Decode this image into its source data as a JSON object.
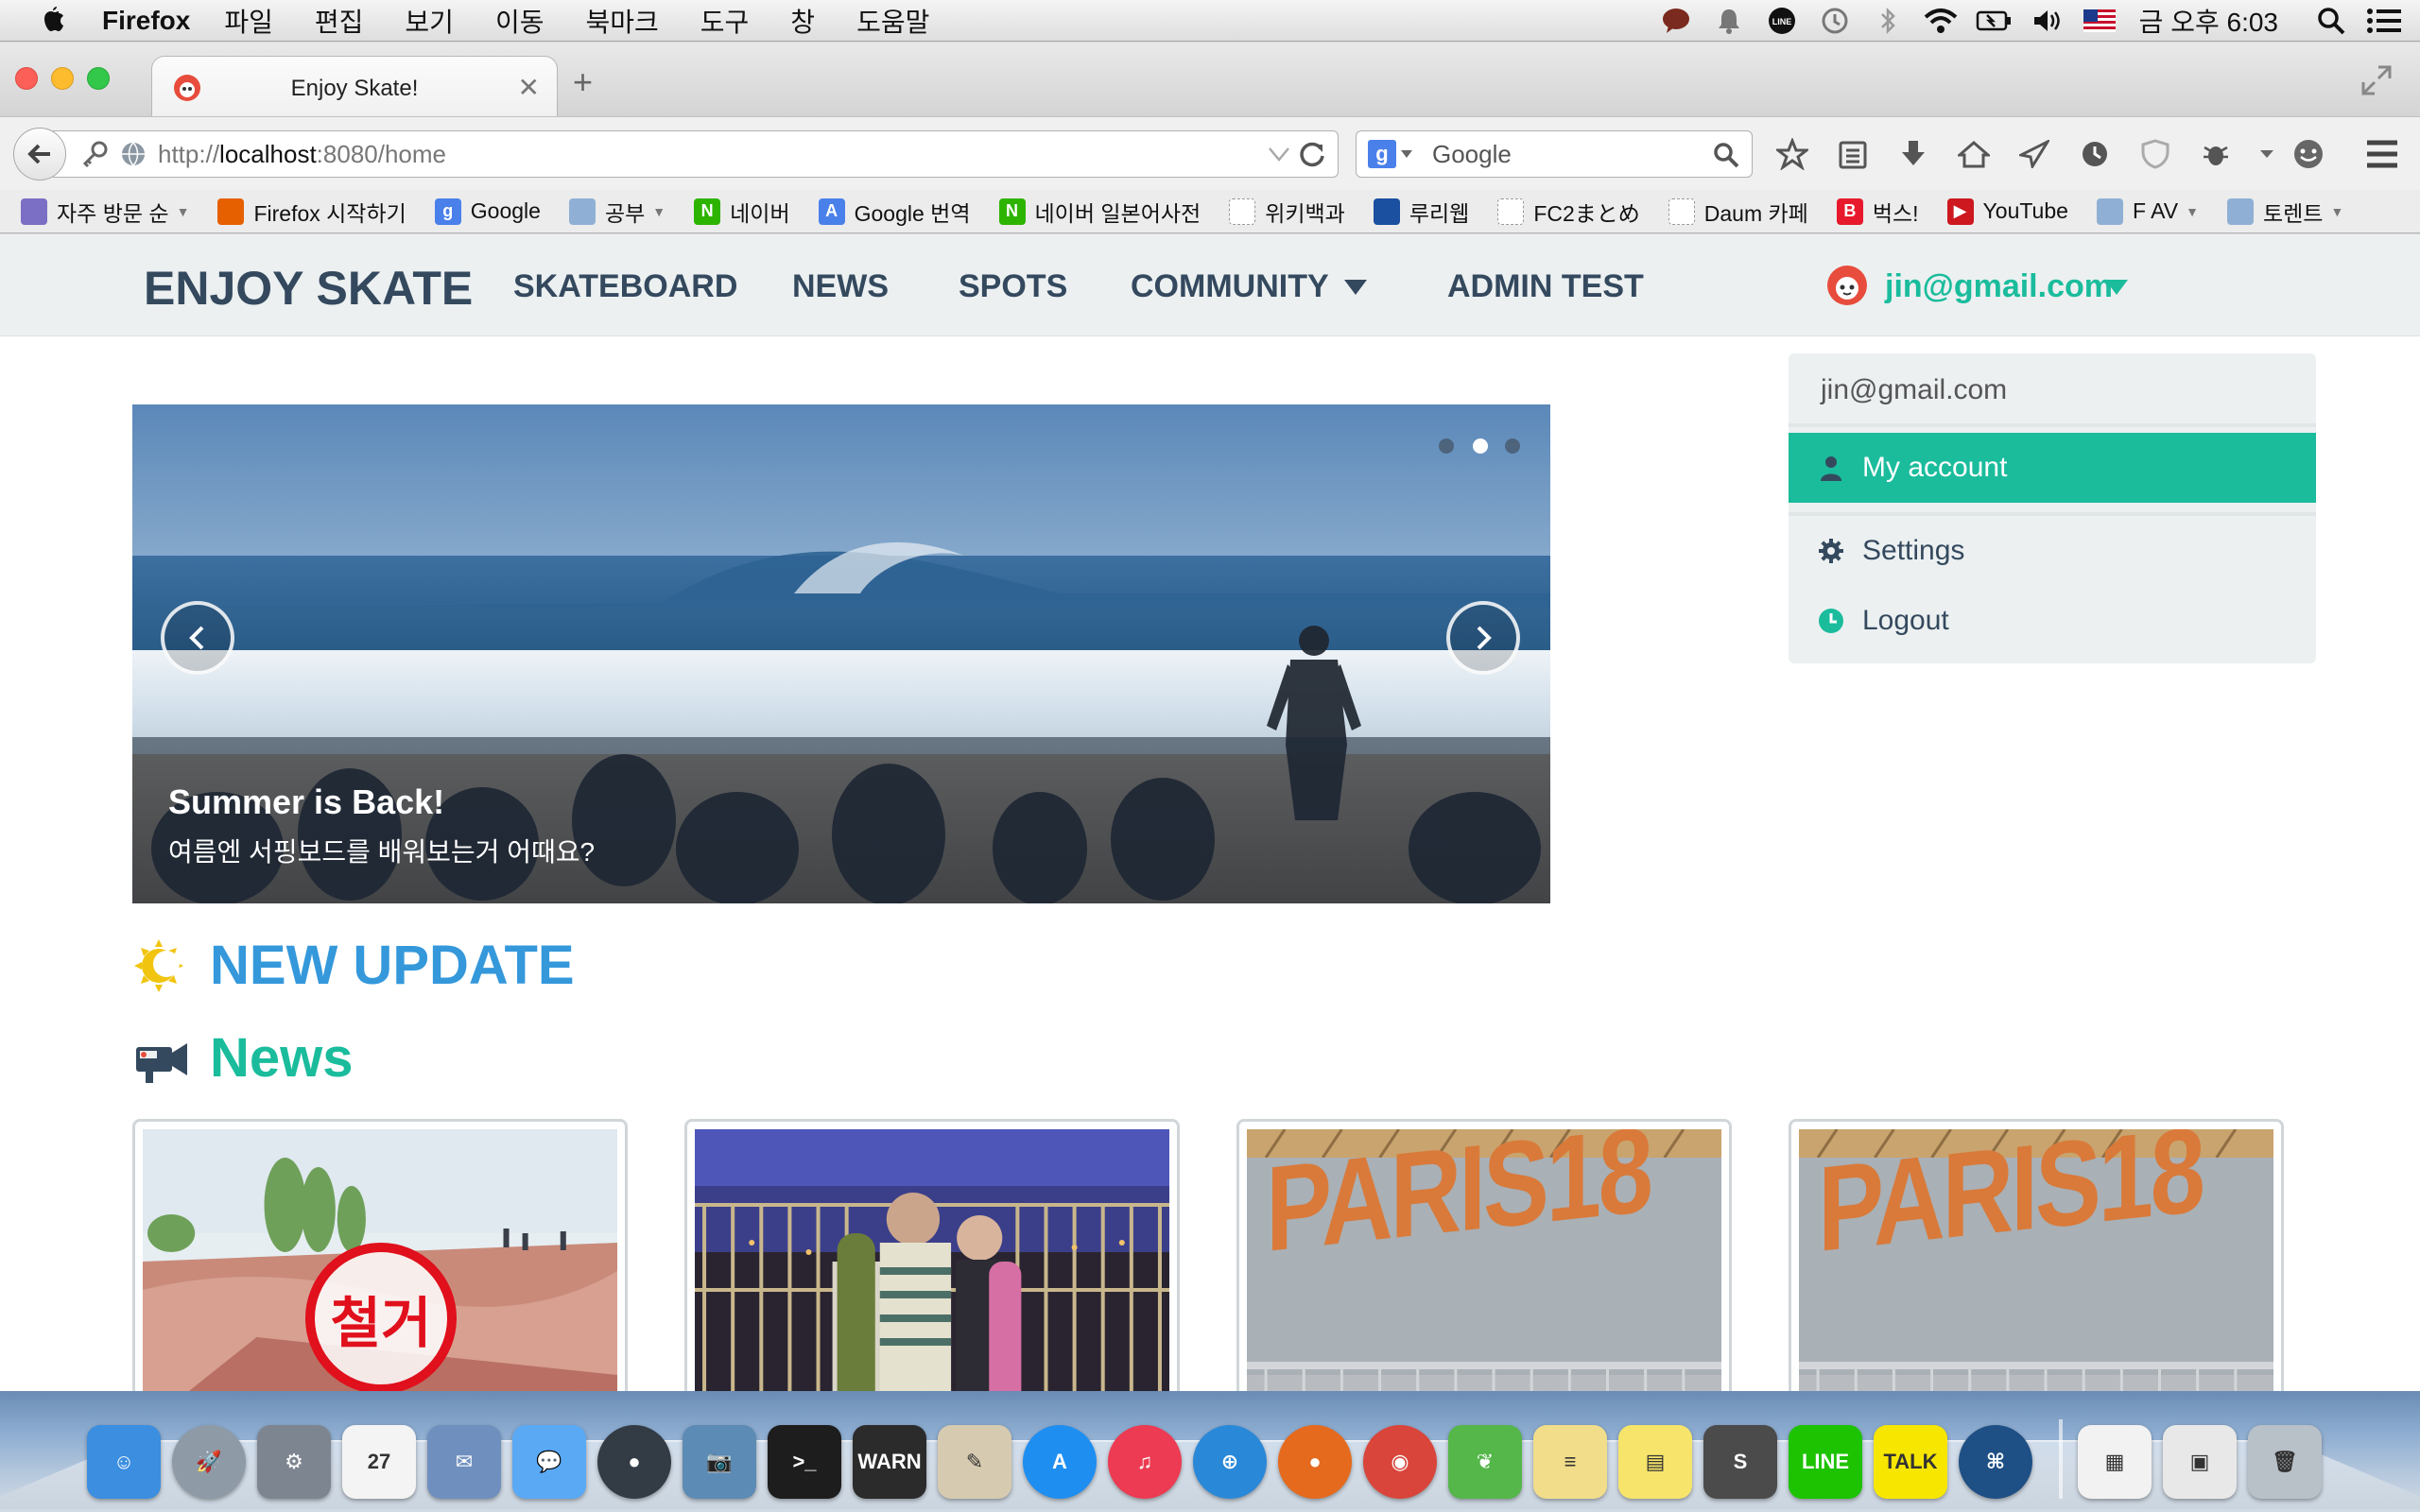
{
  "menubar": {
    "app_name": "Firefox",
    "menus": [
      "파일",
      "편집",
      "보기",
      "이동",
      "북마크",
      "도구",
      "창",
      "도움말"
    ],
    "clock": "금 오후 6:03",
    "status_icons": [
      "messages-icon",
      "notification-bell-icon",
      "line-icon",
      "time-machine-icon",
      "bluetooth-icon",
      "wifi-icon",
      "battery-icon",
      "volume-icon",
      "us-flag-icon"
    ]
  },
  "browser": {
    "tab_title": "Enjoy Skate!",
    "url_protocol": "http://",
    "url_host": "localhost",
    "url_rest": ":8080/home",
    "search_placeholder": "Google",
    "search_engine_letter": "g"
  },
  "bookmarks": [
    {
      "label": "자주 방문 순",
      "icon": "most-visited-icon",
      "color": "#7a6fc4",
      "glyph": "",
      "caret": true
    },
    {
      "label": "Firefox 시작하기",
      "icon": "firefox-icon",
      "color": "#e66000",
      "glyph": "",
      "caret": false
    },
    {
      "label": "Google",
      "icon": "google-icon",
      "color": "#4a80ea",
      "glyph": "g",
      "caret": false
    },
    {
      "label": "공부",
      "icon": "folder-icon",
      "color": "#8fb0d4",
      "glyph": "",
      "caret": true
    },
    {
      "label": "네이버",
      "icon": "naver-icon",
      "color": "#2db400",
      "glyph": "N",
      "caret": false
    },
    {
      "label": "Google 번역",
      "icon": "google-translate-icon",
      "color": "#4a80ea",
      "glyph": "A",
      "caret": false
    },
    {
      "label": "네이버 일본어사전",
      "icon": "naver-icon",
      "color": "#2db400",
      "glyph": "N",
      "caret": false
    },
    {
      "label": "위키백과",
      "icon": "blank-page-icon",
      "color": "#ffffff",
      "glyph": "",
      "caret": false
    },
    {
      "label": "루리웹",
      "icon": "ruliweb-icon",
      "color": "#1b4fa0",
      "glyph": "",
      "caret": false
    },
    {
      "label": "FC2まとめ",
      "icon": "blank-page-icon",
      "color": "#ffffff",
      "glyph": "",
      "caret": false
    },
    {
      "label": "Daum 카페",
      "icon": "blank-page-icon",
      "color": "#ffffff",
      "glyph": "",
      "caret": false
    },
    {
      "label": "벅스!",
      "icon": "bugs-icon",
      "color": "#e8192c",
      "glyph": "B",
      "caret": false
    },
    {
      "label": "YouTube",
      "icon": "youtube-icon",
      "color": "#cc181e",
      "glyph": "▶",
      "caret": false
    },
    {
      "label": "F AV",
      "icon": "folder-icon",
      "color": "#8fb0d4",
      "glyph": "",
      "caret": true
    },
    {
      "label": "토렌트",
      "icon": "folder-icon",
      "color": "#8fb0d4",
      "glyph": "",
      "caret": true
    }
  ],
  "site": {
    "brand": "ENJOY SKATE",
    "nav": [
      "SKATEBOARD",
      "NEWS",
      "SPOTS",
      "COMMUNITY",
      "ADMIN TEST"
    ],
    "user_email": "jin@gmail.com",
    "dropdown": {
      "header": "jin@gmail.com",
      "items": [
        {
          "label": "My account",
          "icon": "user-icon"
        },
        {
          "label": "Settings",
          "icon": "gear-icon"
        },
        {
          "label": "Logout",
          "icon": "clock-icon"
        }
      ]
    },
    "carousel": {
      "title": "Summer is Back!",
      "subtitle": "여름엔 서핑보드를 배워보는거 어때요?",
      "slide_count": 3,
      "active_slide": 2
    },
    "sections": {
      "update_title": "NEW UPDATE",
      "news_title": "News"
    },
    "cards": [
      {
        "image": "skatepark-photo",
        "overlay_text": "철거"
      },
      {
        "image": "skaters-at-night-photo",
        "overlay_text": ""
      },
      {
        "image": "paris18-wall-photo",
        "overlay_text": "PARIS18"
      },
      {
        "image": "paris18-wall-photo",
        "overlay_text": "PARIS18"
      }
    ]
  },
  "colors": {
    "accent_teal": "#1abc9c",
    "accent_blue": "#3498db",
    "nav_text": "#34495e",
    "nav_bg": "#ecf0f1"
  },
  "dock": {
    "apps": [
      {
        "name": "finder-icon",
        "color": "#3b8ee0",
        "glyph": "☺"
      },
      {
        "name": "launchpad-icon",
        "color": "#8e9aa6",
        "glyph": "🚀"
      },
      {
        "name": "system-preferences-icon",
        "color": "#7d8590",
        "glyph": "⚙"
      },
      {
        "name": "calendar-icon",
        "color": "#f4f4f4",
        "glyph": "27"
      },
      {
        "name": "mail-stamp-icon",
        "color": "#6f8fbf",
        "glyph": "✉"
      },
      {
        "name": "messages-icon",
        "color": "#5aa9f5",
        "glyph": "💬"
      },
      {
        "name": "facetime-icon",
        "color": "#333b45",
        "glyph": "●"
      },
      {
        "name": "iphoto-icon",
        "color": "#5c8bb5",
        "glyph": "📷"
      },
      {
        "name": "terminal-icon",
        "color": "#1d1d1d",
        "glyph": ">_"
      },
      {
        "name": "console-icon",
        "color": "#2b2b2b",
        "glyph": "WARN"
      },
      {
        "name": "preview-icon",
        "color": "#d6cbb0",
        "glyph": "✎"
      },
      {
        "name": "app-store-icon",
        "color": "#1f8ef1",
        "glyph": "A"
      },
      {
        "name": "itunes-icon",
        "color": "#ec3b52",
        "glyph": "♫"
      },
      {
        "name": "safari-icon",
        "color": "#2a88d8",
        "glyph": "⊕"
      },
      {
        "name": "firefox-icon",
        "color": "#e56a1d",
        "glyph": "●"
      },
      {
        "name": "chrome-icon",
        "color": "#d9453a",
        "glyph": "◉"
      },
      {
        "name": "spring-leaf-icon",
        "color": "#55b74a",
        "glyph": "❦"
      },
      {
        "name": "notes-icon",
        "color": "#f1dd8a",
        "glyph": "≡"
      },
      {
        "name": "stickies-icon",
        "color": "#f6e46b",
        "glyph": "▤"
      },
      {
        "name": "sublime-text-icon",
        "color": "#4b4b4b",
        "glyph": "S"
      },
      {
        "name": "line-icon",
        "color": "#1dc300",
        "glyph": "LINE"
      },
      {
        "name": "kakaotalk-icon",
        "color": "#f7e600",
        "glyph": "TALK"
      },
      {
        "name": "sourcetree-icon",
        "color": "#1e4f85",
        "glyph": "⌘"
      }
    ],
    "right_items": [
      {
        "name": "document-stack-icon",
        "color": "#f2f2f2",
        "glyph": "▦"
      },
      {
        "name": "downloads-stack-icon",
        "color": "#e8e8e8",
        "glyph": "▣"
      },
      {
        "name": "trash-icon",
        "color": "#b8c0c8",
        "glyph": "🗑"
      }
    ]
  }
}
